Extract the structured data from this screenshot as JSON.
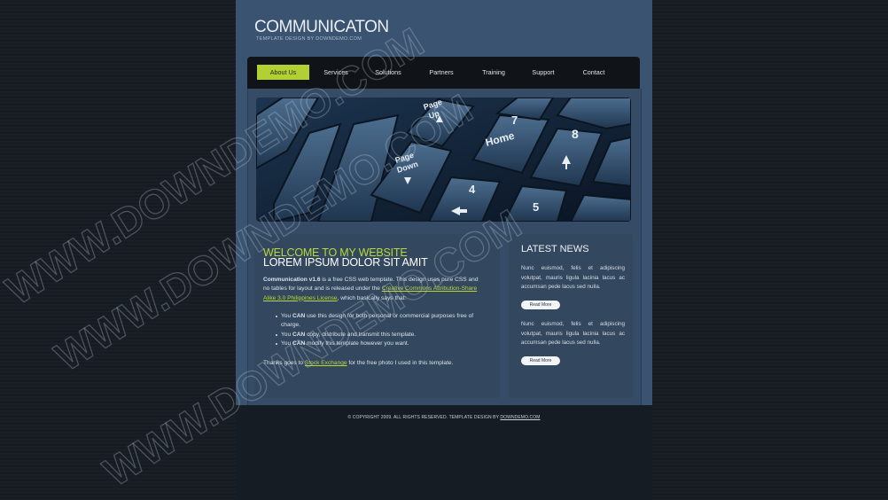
{
  "header": {
    "title": "COMMUNICATON",
    "subtitle": "TEMPLATE DESIGN BY DOWNDEMO.COM"
  },
  "nav": {
    "items": [
      {
        "label": "About Us"
      },
      {
        "label": "Services"
      },
      {
        "label": "Solutions"
      },
      {
        "label": "Partners"
      },
      {
        "label": "Training"
      },
      {
        "label": "Support"
      },
      {
        "label": "Contact"
      }
    ],
    "active_color": "#b2cf33"
  },
  "banner": {
    "keys": [
      {
        "label": "Page Up",
        "icon": "arrow-up-icon"
      },
      {
        "label": "Page Down",
        "icon": "arrow-down-icon"
      },
      {
        "label": "Home"
      },
      {
        "label": "7"
      },
      {
        "label": "8",
        "icon": "arrow-up-icon"
      },
      {
        "label": "4",
        "icon": "arrow-left-icon"
      },
      {
        "label": "5"
      }
    ]
  },
  "main": {
    "title": "WELCOME TO MY WEBSITE",
    "subtitle": "LOREM IPSUM DOLOR SIT AMIT",
    "intro_bold": "Communication v1.6",
    "intro_text": " is a free CSS web template. This design uses pure CSS and no tables for layout and is released under the ",
    "license_link": "Creative Commons Attribution-Share Alike 3.0 Philippines License",
    "intro_tail": ", which basically says that:",
    "bullets": [
      {
        "pre": "You ",
        "bold": "CAN",
        "post": " use this design for both personal or commercial purposes free of charge."
      },
      {
        "pre": "You ",
        "bold": "CAN",
        "post": " copy, distribute and transmit this template."
      },
      {
        "pre": "You ",
        "bold": "CAN",
        "post": " modify this template however you want."
      }
    ],
    "thanks_pre": "Thanks goes to ",
    "thanks_link": "Stock Exchange",
    "thanks_post": " for the free photo I used in this template."
  },
  "sidebar": {
    "title": "LATEST NEWS",
    "news": [
      {
        "text": "Nunc euismod, felis et adipiscing volutpat, mauris ligula lacinia lacus ac accumsan pede lacus sed nulla.",
        "button": "Read More"
      },
      {
        "text": "Nunc euismod, felis et adipiscing volutpat, mauris ligula lacinia lacus ac accumsan pede lacus sed nulla.",
        "button": "Read More"
      }
    ]
  },
  "footer": {
    "text": "© COPYRIGHT 2009. ALL RIGHTS RESERVED. TEMPLATE DESIGN BY ",
    "link": "DOWNDEMO.COM"
  },
  "watermark": {
    "text": "WWW.DOWNDEMO.COM"
  },
  "colors": {
    "accent": "#b2cf33",
    "page_bg": "#3a5370",
    "outer_bg": "#171c23"
  }
}
